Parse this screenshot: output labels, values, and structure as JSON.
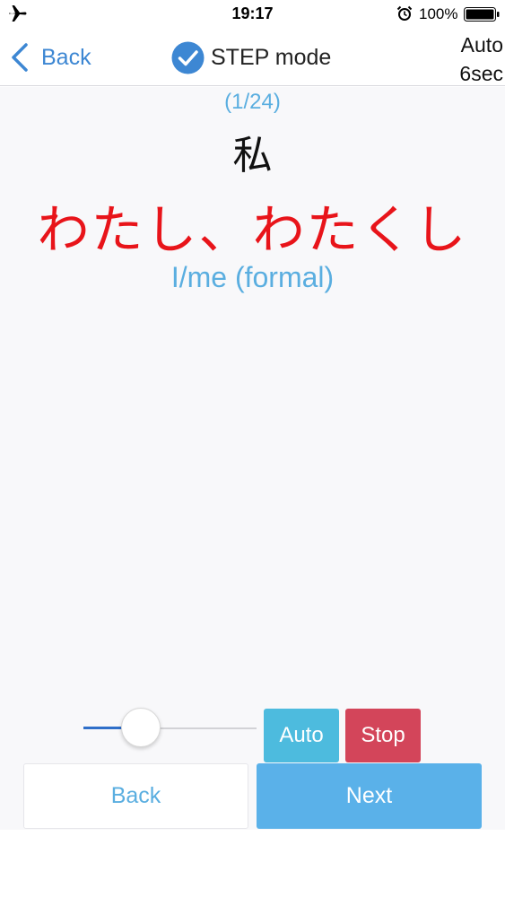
{
  "status_bar": {
    "time": "19:17",
    "battery_percent": "100%",
    "icons": [
      "airplane-icon",
      "alarm-icon",
      "battery-icon"
    ],
    "battery_level": 1.0
  },
  "nav": {
    "back_label": "Back",
    "title": "STEP mode",
    "auto_line1": "Auto",
    "auto_line2": "6sec",
    "check_color": "#3d87d3"
  },
  "card": {
    "counter": "(1/24)",
    "kanji": "私",
    "reading": "わたし、わたくし",
    "meaning": "I/me (formal)",
    "reading_color": "#e8141a",
    "meaning_color": "#5aaee0"
  },
  "controls": {
    "slider_value": 0.15,
    "auto_label": "Auto",
    "stop_label": "Stop",
    "back_label": "Back",
    "next_label": "Next",
    "colors": {
      "auto": "#4dbbde",
      "stop": "#d3455a",
      "next": "#5ab1e9"
    }
  }
}
